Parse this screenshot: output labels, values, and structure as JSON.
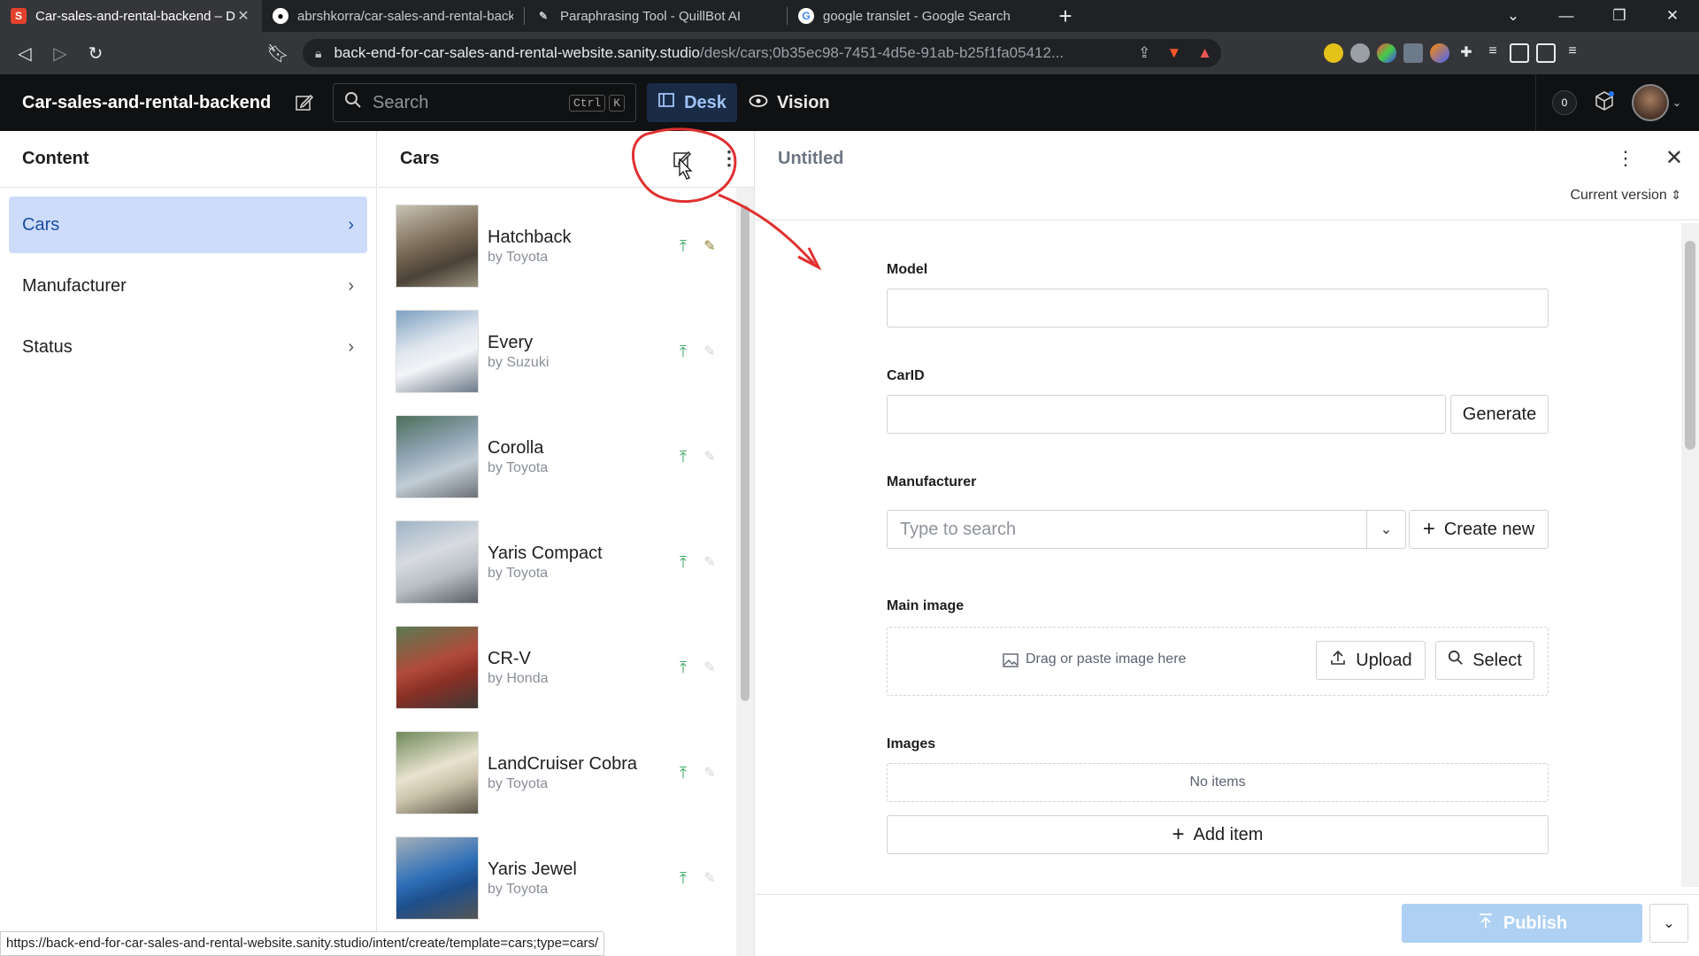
{
  "browser": {
    "tabs": [
      {
        "title": "Car-sales-and-rental-backend – D",
        "favicon": "S",
        "active": true
      },
      {
        "title": "abrshkorra/car-sales-and-rental-backe",
        "favicon": "github"
      },
      {
        "title": "Paraphrasing Tool - QuillBot AI",
        "favicon": "quill"
      },
      {
        "title": "google translet - Google Search",
        "favicon": "G"
      }
    ],
    "url_host": "back-end-for-car-sales-and-rental-website.sanity.studio",
    "url_path": "/desk/cars;0b35ec98-7451-4d5e-91ab-b25f1fa05412..."
  },
  "app": {
    "title": "Car-sales-and-rental-backend",
    "search_placeholder": "Search",
    "shortcut_ctrl": "Ctrl",
    "shortcut_k": "K",
    "desk_label": "Desk",
    "vision_label": "Vision",
    "notifications_count": "0"
  },
  "content_pane": {
    "title": "Content",
    "items": [
      {
        "label": "Cars",
        "selected": true
      },
      {
        "label": "Manufacturer"
      },
      {
        "label": "Status"
      }
    ]
  },
  "cars_pane": {
    "title": "Cars",
    "items": [
      {
        "name": "Hatchback",
        "by": "by Toyota",
        "thumb_color": "#7a6a55"
      },
      {
        "name": "Every",
        "by": "by Suzuki",
        "thumb_color": "#9ab0c8"
      },
      {
        "name": "Corolla",
        "by": "by Toyota",
        "thumb_color": "#8fa4b3"
      },
      {
        "name": "Yaris Compact",
        "by": "by Toyota",
        "thumb_color": "#b8bec4"
      },
      {
        "name": "CR-V",
        "by": "by Honda",
        "thumb_color": "#b04a3a"
      },
      {
        "name": "LandCruiser Cobra",
        "by": "by Toyota",
        "thumb_color": "#c9c0a8"
      },
      {
        "name": "Yaris Jewel",
        "by": "by Toyota",
        "thumb_color": "#2e6fb8"
      }
    ]
  },
  "editor": {
    "title": "Untitled",
    "version_label": "Current version",
    "fields": {
      "model_label": "Model",
      "carid_label": "CarID",
      "generate_label": "Generate",
      "manufacturer_label": "Manufacturer",
      "manufacturer_placeholder": "Type to search",
      "create_new_label": "Create new",
      "main_image_label": "Main image",
      "dropzone_text": "Drag or paste image here",
      "upload_label": "Upload",
      "select_label": "Select",
      "images_label": "Images",
      "no_items_text": "No items",
      "add_item_label": "Add item"
    },
    "publish_label": "Publish"
  },
  "status_bar_url": "https://back-end-for-car-sales-and-rental-website.sanity.studio/intent/create/template=cars;type=cars/",
  "colors": {
    "accent": "#1c4da1",
    "selected_bg": "#cddcfb",
    "publish_bg": "#aed0f3",
    "annotation": "#e03030"
  }
}
